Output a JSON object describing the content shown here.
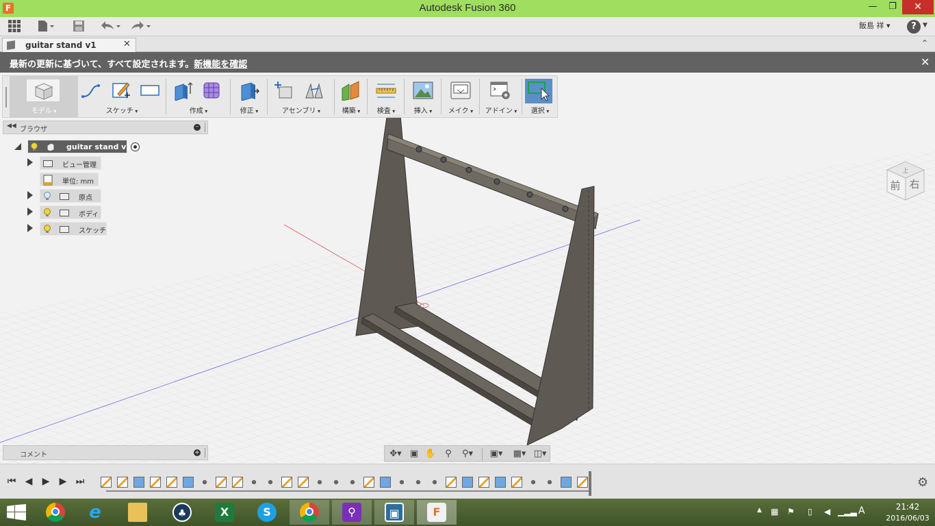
{
  "app": {
    "title": "Autodesk Fusion 360",
    "logo_letter": "F",
    "user_name": "飯島 祥 ▾",
    "help_label": "?"
  },
  "document": {
    "tab_label": "guitar stand v1",
    "tab_close": "✕"
  },
  "notification": {
    "text": "最新の更新に基づいて、すべて設定されます。",
    "link": "新機能を確認",
    "close": "✕"
  },
  "ribbon": {
    "groups": [
      {
        "label": "モデル"
      },
      {
        "label": "スケッチ"
      },
      {
        "label": "作成"
      },
      {
        "label": "修正"
      },
      {
        "label": "アセンブリ"
      },
      {
        "label": "構築"
      },
      {
        "label": "検査"
      },
      {
        "label": "挿入"
      },
      {
        "label": "メイク"
      },
      {
        "label": "アドイン"
      },
      {
        "label": "選択"
      }
    ]
  },
  "browser": {
    "title": "ブラウザ",
    "root": "guitar stand v1",
    "items": [
      {
        "label": "ビュー管理"
      },
      {
        "label": "単位: mm"
      },
      {
        "label": "原点"
      },
      {
        "label": "ボディ"
      },
      {
        "label": "スケッチ"
      }
    ]
  },
  "comments": {
    "title": "コメント"
  },
  "viewcube": {
    "front": "前",
    "right": "右",
    "top": "上"
  },
  "taskbar": {
    "time": "21:42",
    "date": "2016/06/03",
    "ime": "A"
  },
  "colors": {
    "titlebar": "#9fde5f",
    "close": "#c7302a",
    "notification": "#626262",
    "model_body": "#5e5952",
    "axis_red": "#e25555",
    "axis_blue": "#6b6bdd"
  }
}
